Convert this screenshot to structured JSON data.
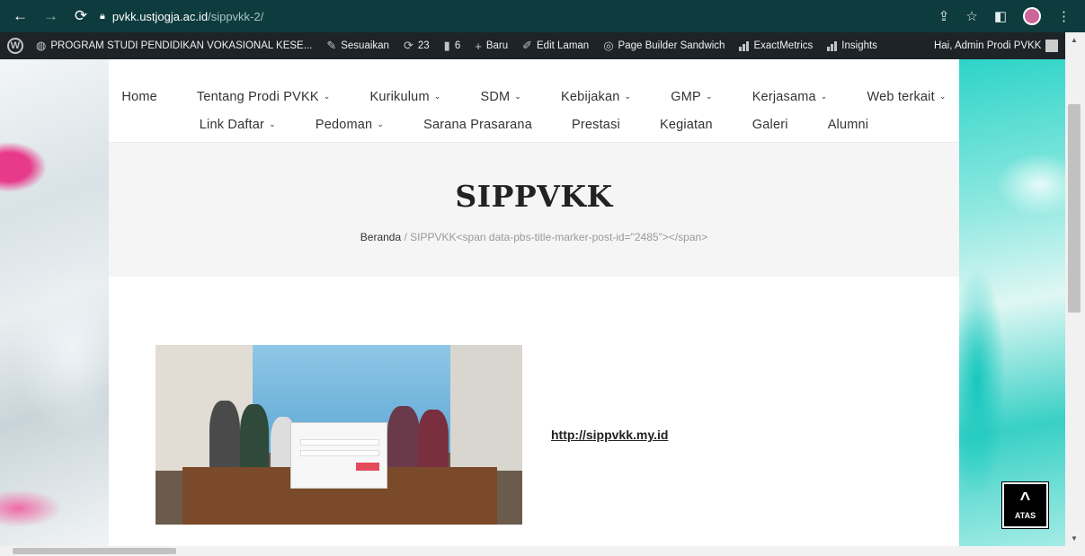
{
  "browser": {
    "url_host": "pvkk.ustjogja.ac.id",
    "url_path": "/sippvkk-2/",
    "nav_icons": [
      "back-icon",
      "forward-icon",
      "reload-icon"
    ]
  },
  "wp_admin_bar": {
    "site_name": "PROGRAM STUDI PENDIDIKAN VOKASIONAL KESE...",
    "customize": "Sesuaikan",
    "updates_count": "23",
    "comments_count": "6",
    "new": "Baru",
    "edit_page": "Edit Laman",
    "page_builder": "Page Builder Sandwich",
    "exactmetrics": "ExactMetrics",
    "insights": "Insights",
    "greeting": "Hai, Admin Prodi PVKK"
  },
  "menu": {
    "row1": [
      {
        "label": "Home",
        "caret": false
      },
      {
        "label": "Tentang Prodi PVKK",
        "caret": true
      },
      {
        "label": "Kurikulum",
        "caret": true
      },
      {
        "label": "SDM",
        "caret": true
      },
      {
        "label": "Kebijakan",
        "caret": true
      },
      {
        "label": "GMP",
        "caret": true
      },
      {
        "label": "Kerjasama",
        "caret": true
      },
      {
        "label": "Web terkait",
        "caret": true
      }
    ],
    "row2": [
      {
        "label": "Link Daftar",
        "caret": true
      },
      {
        "label": "Pedoman",
        "caret": true
      },
      {
        "label": "Sarana Prasarana",
        "caret": false
      },
      {
        "label": "Prestasi",
        "caret": false
      },
      {
        "label": "Kegiatan",
        "caret": false
      },
      {
        "label": "Galeri",
        "caret": false
      },
      {
        "label": "Alumni",
        "caret": false
      }
    ]
  },
  "page": {
    "title": "SIPPVKK",
    "breadcrumb_home": "Beranda",
    "breadcrumb_sep": " / ",
    "breadcrumb_current": "SIPPVKK<span data-pbs-title-marker-post-id=\"2485\"></span>",
    "link": "http://sippvkk.my.id"
  },
  "back_to_top": {
    "label": "ATAS"
  },
  "colors": {
    "chrome_bar": "#0e3b3e",
    "wp_bar": "#1d2327",
    "title_bg": "#f5f5f5"
  }
}
